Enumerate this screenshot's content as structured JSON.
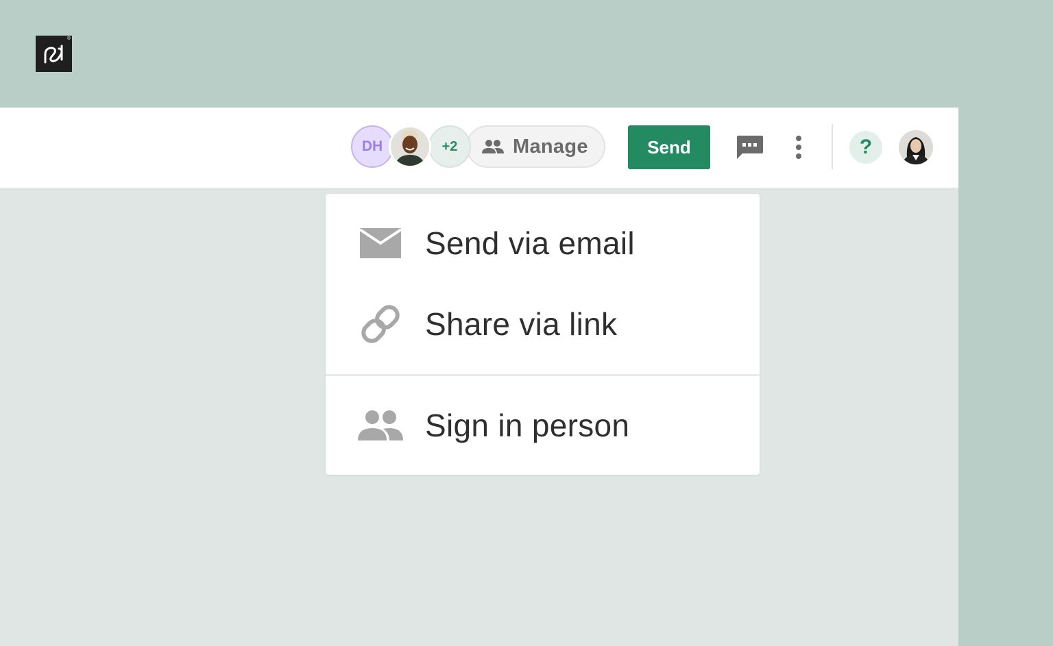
{
  "logo": {
    "name": "pandadoc-logo",
    "mark": "®"
  },
  "header": {
    "collaborators": {
      "initials": "DH",
      "extra_count": "+2",
      "manage_label": "Manage"
    },
    "send_label": "Send",
    "help_label": "?"
  },
  "send_menu": {
    "items": [
      {
        "label": "Send via email",
        "icon": "envelope-icon"
      },
      {
        "label": "Share via link",
        "icon": "link-icon"
      },
      {
        "label": "Sign in person",
        "icon": "people-icon"
      }
    ]
  },
  "colors": {
    "accent": "#248a62",
    "background": "#b8cec6",
    "canvas": "#dfe6e3",
    "icon_gray": "#a8a8a8"
  }
}
